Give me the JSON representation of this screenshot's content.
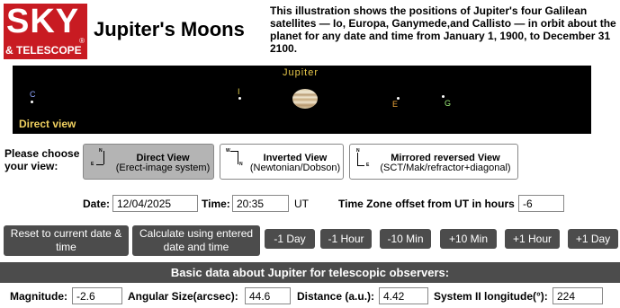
{
  "logo": {
    "line1": "SKY",
    "line2": "& TELESCOPE",
    "mark": "®"
  },
  "header": {
    "title": "Jupiter's Moons",
    "intro": "This illustration shows the positions of Jupiter's four Galilean satellites — Io, Europa, Ganymede,and Callisto — in orbit about the planet for any date and time from January 1, 1900, to December 31 2100."
  },
  "sky_view": {
    "planet_label": "Jupiter",
    "mode_label": "Direct view",
    "moons": [
      {
        "key": "C",
        "color": "#8fa6ff"
      },
      {
        "key": "I",
        "color": "#e8d44a"
      },
      {
        "key": "E",
        "color": "#f2a93b"
      },
      {
        "key": "G",
        "color": "#9ff07a"
      }
    ]
  },
  "view_choice": {
    "prompt": "Please choose your view:",
    "options": [
      {
        "title": "Direct View",
        "subtitle": "(Erect-image system)",
        "selected": true
      },
      {
        "title": "Inverted View",
        "subtitle": "(Newtonian/Dobson)",
        "selected": false
      },
      {
        "title": "Mirrored reversed View",
        "subtitle": "(SCT/Mak/refractor+diagonal)",
        "selected": false
      }
    ],
    "axis_labels": {
      "n": "N",
      "e": "E",
      "w": "W"
    }
  },
  "datetime": {
    "date_label": "Date:",
    "date_value": "12/04/2025",
    "time_label": "Time:",
    "time_value": "20:35",
    "ut_label": "UT",
    "tz_label": "Time Zone offset from UT in hours",
    "tz_value": "-6"
  },
  "actions": {
    "reset": "Reset to current date & time",
    "calculate": "Calculate using entered date and time",
    "steps": [
      "-1 Day",
      "-1 Hour",
      "-10 Min",
      "+10 Min",
      "+1 Hour",
      "+1 Day"
    ]
  },
  "basic_data": {
    "heading": "Basic data about Jupiter for telescopic observers:",
    "magnitude_label": "Magnitude:",
    "magnitude_value": "-2.6",
    "angular_label": "Angular Size(arcsec):",
    "angular_value": "44.6",
    "distance_label": "Distance (a.u.):",
    "distance_value": "4.42",
    "longitude_label": "System II longitude(°):",
    "longitude_value": "224"
  },
  "colors": {
    "brand_red": "#c81b22",
    "dark_button": "#4c4c4c",
    "selected_button": "#b4b4b4",
    "panel_bg": "#000000"
  }
}
